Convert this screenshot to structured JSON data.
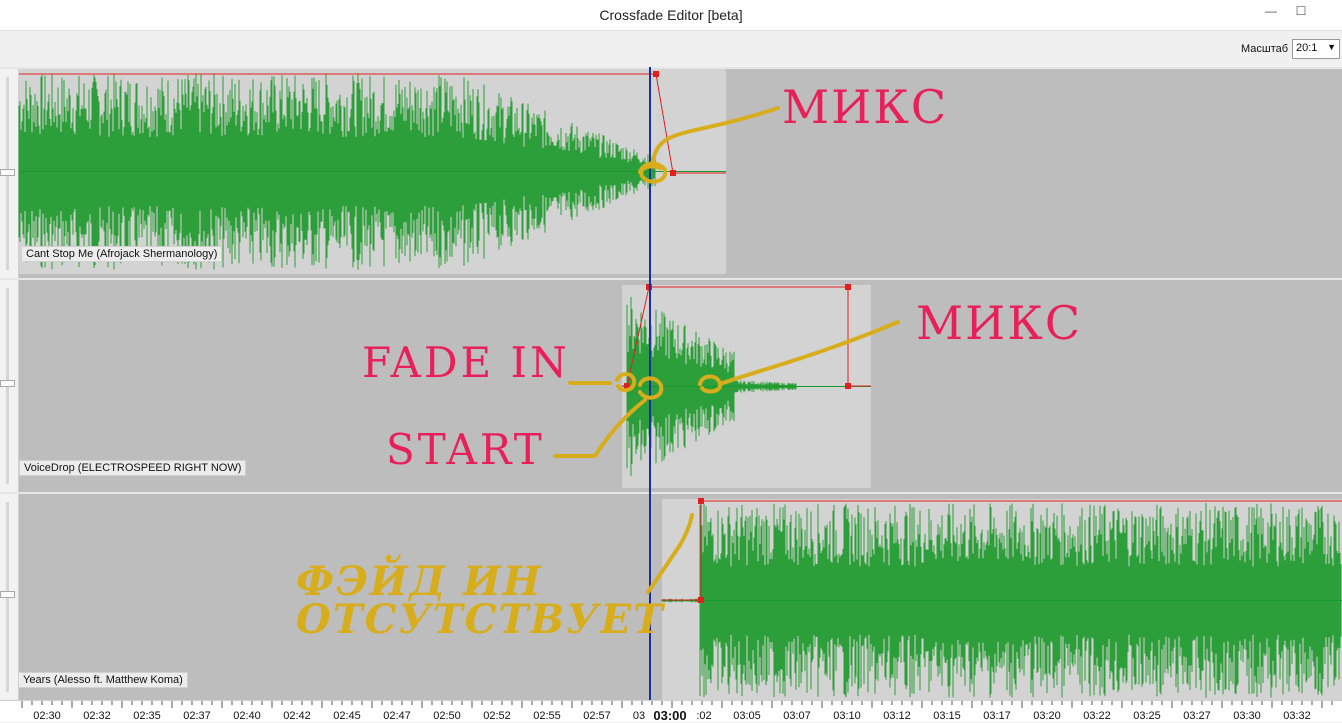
{
  "window": {
    "title": "Crossfade Editor [beta]",
    "minimize_glyph": "—",
    "maximize_glyph": "☐",
    "close_glyph": "✕"
  },
  "toolbar": {
    "scale_label": "Масштаб",
    "scale_value": "20:1"
  },
  "tracks": [
    {
      "label": "Cant Stop Me (Afrojack  Shermanology)"
    },
    {
      "label": "VoiceDrop (ELECTROSPEED RIGHT NOW)"
    },
    {
      "label": "Years (Alesso ft. Matthew Koma)"
    }
  ],
  "timeline": {
    "ticks": [
      "02:30",
      "02:32",
      "02:35",
      "02:37",
      "02:40",
      "02:42",
      "02:45",
      "02:47",
      "02:50",
      "02:52",
      "02:55",
      "02:57",
      "03",
      "03:00",
      ":02",
      "03:05",
      "03:07",
      "03:10",
      "03:12",
      "03:15",
      "03:17",
      "03:20",
      "03:22",
      "03:25",
      "03:27",
      "03:30",
      "03:32"
    ],
    "current": "03:00"
  },
  "annotations": {
    "mix_top": "МИКС",
    "mix_mid": "МИКС",
    "fade_in": "FADE IN",
    "start": "START",
    "no_fade_line1": "ФЭЙД ИН",
    "no_fade_line2": "ОТСУТСТВУЕТ"
  },
  "colors": {
    "waveform": "#1a9a2a",
    "envelope": "#e02020",
    "playhead": "#1a2fa0",
    "annotation_pink": "#e8205a",
    "annotation_gold": "#d8ad1c"
  }
}
